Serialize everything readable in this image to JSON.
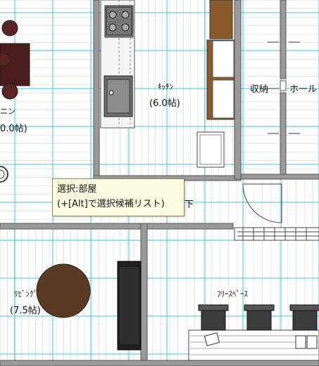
{
  "rooms": {
    "kitchen": {
      "name": "ｷｯﾁﾝ",
      "size": "(6.0帖)"
    },
    "storage": {
      "name": "収納"
    },
    "hall": {
      "name": "ホール"
    },
    "living": {
      "name": "ﾘﾋﾞﾝｸﾞ",
      "size": "(7.5帖)"
    },
    "free_space": {
      "name": "ﾌﾘｰｽﾍﾟｰｽ"
    },
    "left_room_partial": {
      "name": "ニン",
      "size": "0.0帖)"
    },
    "corridor_partial": {
      "name": "下"
    }
  },
  "tooltip": {
    "line1": "選択:部屋",
    "line2": "(+[Alt]で選択候補リスト)"
  },
  "colors": {
    "wall": "#909090",
    "grid": "#00b0d8",
    "floor_line": "#d6d6d6",
    "cabinet": "#8a5a2b",
    "table_dark": "#4a1c1c",
    "round_table": "#5a3a22",
    "chair": "#3c3c3c",
    "tooltip_bg": "#fffde1"
  }
}
